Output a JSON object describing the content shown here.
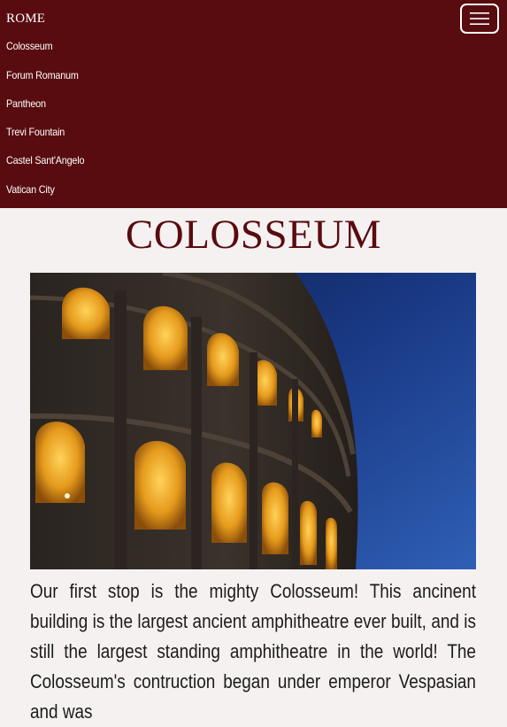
{
  "navbar": {
    "brand": "ROME",
    "toggler_icon": "hamburger-menu-icon",
    "items": [
      {
        "label": "Colosseum"
      },
      {
        "label": "Forum Romanum"
      },
      {
        "label": "Pantheon"
      },
      {
        "label": "Trevi Fountain"
      },
      {
        "label": "Castel Sant'Angelo"
      },
      {
        "label": "Vatican City"
      }
    ]
  },
  "main": {
    "title": "COLOSSEUM",
    "body": "Our first stop is the mighty Colosseum! This ancinent building is the largest ancient amphitheatre ever built, and is still the largest standing amphitheatre in the world! The Colosseum's contruction began under emperor Vespasian and was"
  },
  "colors": {
    "navbar_bg": "#580c0f",
    "title": "#580c0f",
    "page_bg": "#f6f1f1"
  }
}
